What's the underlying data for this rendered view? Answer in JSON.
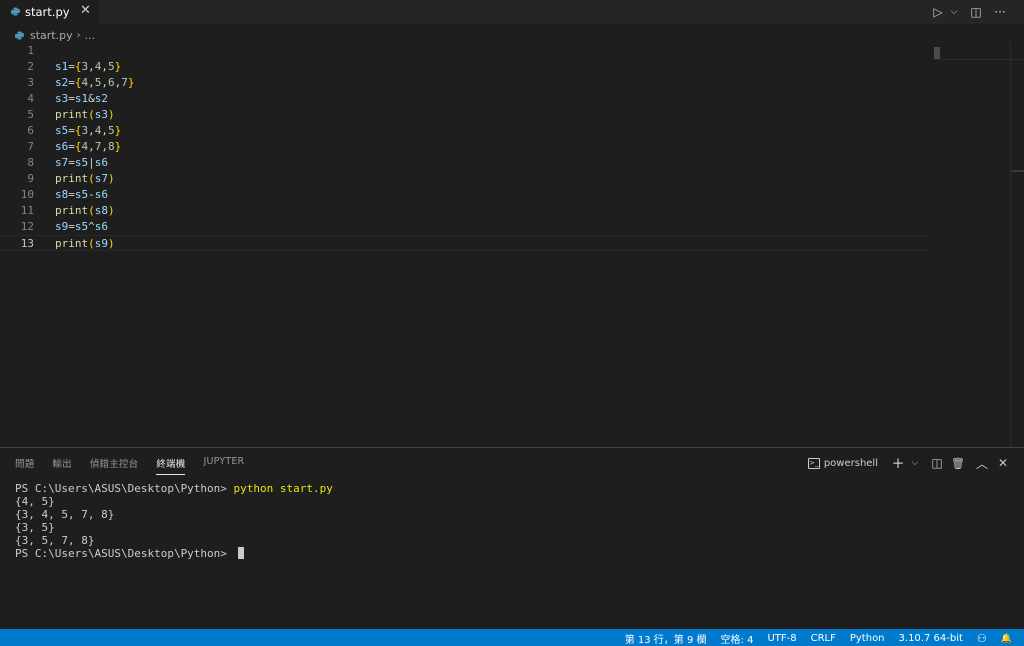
{
  "tab": {
    "label": "start.py",
    "close": "✕"
  },
  "toolbar": {
    "run": "▷",
    "run_menu": "⌵",
    "split": "◫",
    "more": "···"
  },
  "breadcrumb": {
    "file": "start.py",
    "sep": "›",
    "rest": "..."
  },
  "editor": {
    "current_line": 13,
    "lines": [
      {
        "num": "1"
      },
      {
        "num": "2"
      },
      {
        "num": "3"
      },
      {
        "num": "4"
      },
      {
        "num": "5"
      },
      {
        "num": "6"
      },
      {
        "num": "7"
      },
      {
        "num": "8"
      },
      {
        "num": "9"
      },
      {
        "num": "10"
      },
      {
        "num": "11"
      },
      {
        "num": "12"
      },
      {
        "num": "13"
      }
    ]
  },
  "panel": {
    "tabs": [
      "問題",
      "輸出",
      "偵錯主控台",
      "終端機",
      "JUPYTER"
    ],
    "active_tab": "終端機",
    "shell": "powershell",
    "actions": {
      "add": "+",
      "add_menu": "⌵",
      "split": "◫",
      "trash": "🗑",
      "maximize": "︿",
      "close": "✕"
    }
  },
  "terminal": {
    "prompt": "PS C:\\Users\\ASUS\\Desktop\\Python> ",
    "command": "python start.py",
    "output": [
      "{4, 5}",
      "{3, 4, 5, 7, 8}",
      "{3, 5}",
      "{3, 5, 7, 8}"
    ]
  },
  "statusbar": {
    "position": "第 13 行，第 9 欄",
    "spaces": "空格: 4",
    "encoding": "UTF-8",
    "eol": "CRLF",
    "language": "Python",
    "interpreter": "3.10.7 64-bit",
    "feedback": "⚇",
    "bell": "🔔"
  },
  "colors": {
    "statusbar": "#007acc",
    "editor_bg": "#1e1e1e",
    "variable": "#9cdcfe",
    "function": "#dcdcaa",
    "bracket": "#ffd700",
    "number": "#b5cea8"
  }
}
